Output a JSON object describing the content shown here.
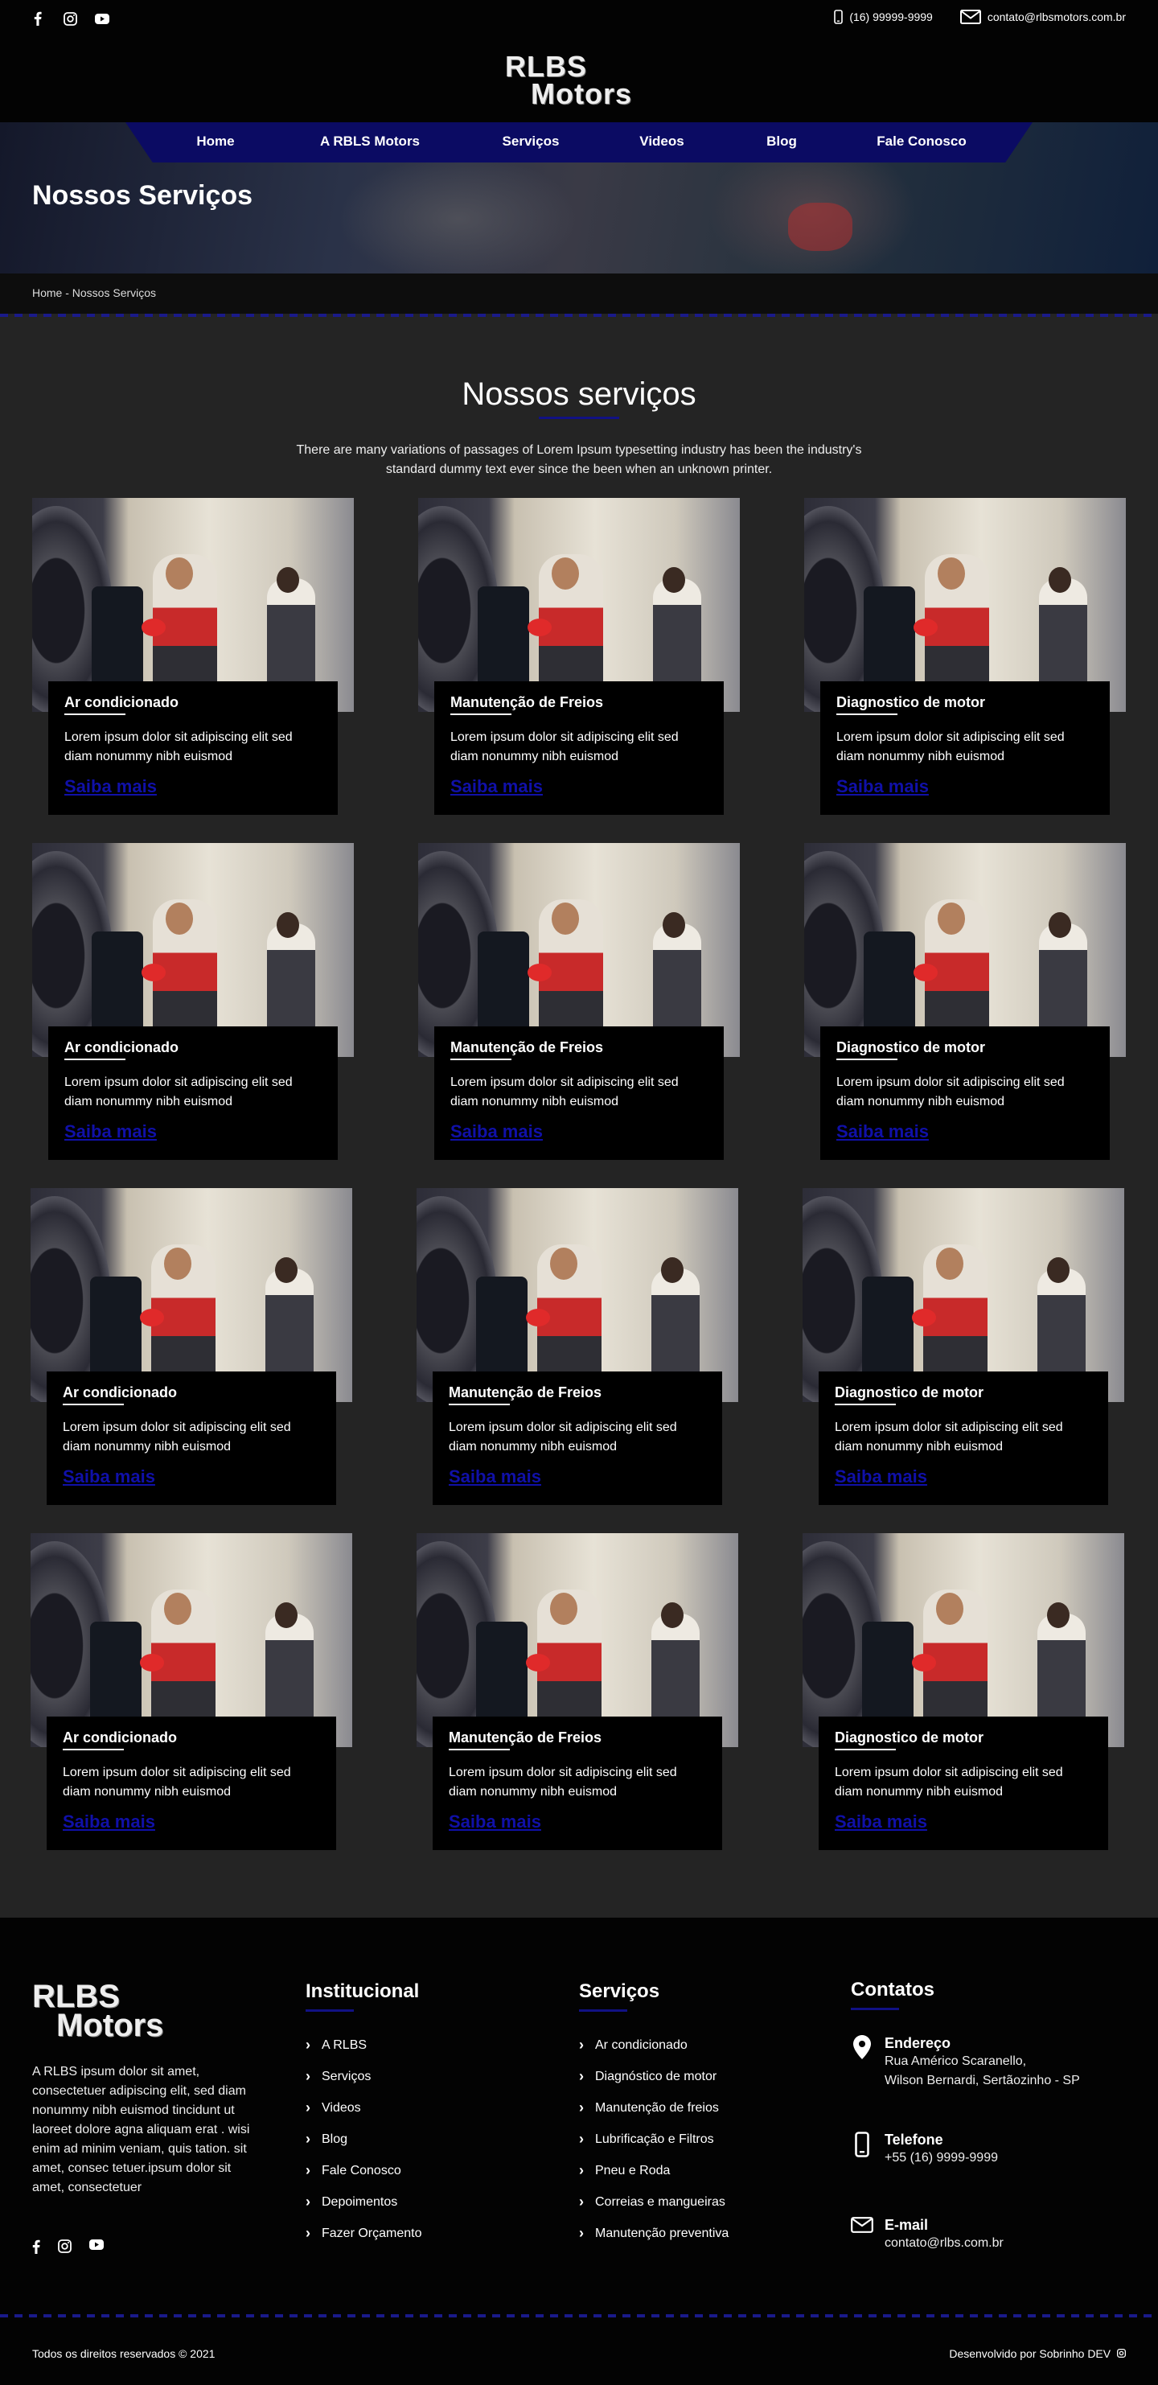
{
  "header": {
    "phone": "(16) 99999-9999",
    "email": "contato@rlbsmotors.com.br",
    "logo_line1": "RLBS",
    "logo_line2": "Motors",
    "social_icons": [
      "facebook-icon",
      "instagram-icon",
      "youtube-icon"
    ]
  },
  "nav": {
    "items": [
      {
        "label": "Home"
      },
      {
        "label": "A  RBLS  Motors"
      },
      {
        "label": "Serviços"
      },
      {
        "label": "Videos"
      },
      {
        "label": "Blog"
      },
      {
        "label": "Fale  Conosco"
      }
    ]
  },
  "hero": {
    "title": "Nossos Serviços"
  },
  "breadcrumb": "Home - Nossos Serviços",
  "section": {
    "title": "Nossos serviços",
    "description": "There are many variations of passages of Lorem Ipsum typesetting industry has been the industry's standard dummy text ever since the been when an unknown printer."
  },
  "cards": [
    {
      "title": "Ar condicionado",
      "desc": "Lorem ipsum dolor sit adipiscing elit sed diam nonummy nibh euismod",
      "more": "Saiba mais"
    },
    {
      "title": "Manutenção de Freios",
      "desc": "Lorem ipsum dolor sit adipiscing elit sed diam nonummy nibh euismod",
      "more": "Saiba mais"
    },
    {
      "title": "Diagnostico de motor",
      "desc": "Lorem ipsum dolor sit adipiscing elit sed diam nonummy nibh euismod",
      "more": "Saiba mais"
    },
    {
      "title": "Ar condicionado",
      "desc": "Lorem ipsum dolor sit adipiscing elit sed diam nonummy nibh euismod",
      "more": "Saiba mais"
    },
    {
      "title": "Manutenção de Freios",
      "desc": "Lorem ipsum dolor sit adipiscing elit sed diam nonummy nibh euismod",
      "more": "Saiba mais"
    },
    {
      "title": "Diagnostico de motor",
      "desc": "Lorem ipsum dolor sit adipiscing elit sed diam nonummy nibh euismod",
      "more": "Saiba mais"
    },
    {
      "title": "Ar condicionado",
      "desc": "Lorem ipsum dolor sit adipiscing elit sed diam nonummy nibh euismod",
      "more": "Saiba mais"
    },
    {
      "title": "Manutenção de Freios",
      "desc": "Lorem ipsum dolor sit adipiscing elit sed diam nonummy nibh euismod",
      "more": "Saiba mais"
    },
    {
      "title": "Diagnostico de motor",
      "desc": "Lorem ipsum dolor sit adipiscing elit sed diam nonummy nibh euismod",
      "more": "Saiba mais"
    },
    {
      "title": "Ar condicionado",
      "desc": "Lorem ipsum dolor sit adipiscing elit sed diam nonummy nibh euismod",
      "more": "Saiba mais"
    },
    {
      "title": "Manutenção de Freios",
      "desc": "Lorem ipsum dolor sit adipiscing elit sed diam nonummy nibh euismod",
      "more": "Saiba mais"
    },
    {
      "title": "Diagnostico de motor",
      "desc": "Lorem ipsum dolor sit adipiscing elit sed diam nonummy nibh euismod",
      "more": "Saiba mais"
    }
  ],
  "footer": {
    "logo_line1": "RLBS",
    "logo_line2": "Motors",
    "about": "A RLBS ipsum dolor sit amet, consectetuer adipiscing elit, sed diam nonummy nibh euismod tincidunt ut laoreet dolore agna aliquam erat . wisi enim ad minim veniam, quis tation. sit amet, consec tetuer.ipsum dolor sit amet, consectetuer",
    "institucional": {
      "title": "Institucional",
      "items": [
        "A RLBS",
        "Serviços",
        "Videos",
        "Blog",
        "Fale Conosco",
        "Depoimentos",
        "Fazer Orçamento"
      ]
    },
    "servicos": {
      "title": "Serviços",
      "items": [
        "Ar condicionado",
        "Diagnóstico de motor",
        "Manutenção de freios",
        "Lubrificação e Filtros",
        "Pneu e Roda",
        "Correias e mangueiras",
        "Manutenção preventiva"
      ]
    },
    "contatos": {
      "title": "Contatos",
      "endereco_label": "Endereço",
      "endereco_line1": "Rua Américo Scaranello,",
      "endereco_line2": "Wilson Bernardi, Sertãozinho - SP",
      "telefone_label": "Telefone",
      "telefone": "+55 (16) 9999-9999",
      "email_label": "E-mail",
      "email": "contato@rlbs.com.br"
    },
    "copyright": "Todos os direitos reservados © 2021",
    "developer": "Desenvolvido por Sobrinho DEV"
  },
  "colors": {
    "accent": "#0b0b63",
    "link": "#1010a8",
    "background": "#242424",
    "black": "#030303"
  }
}
